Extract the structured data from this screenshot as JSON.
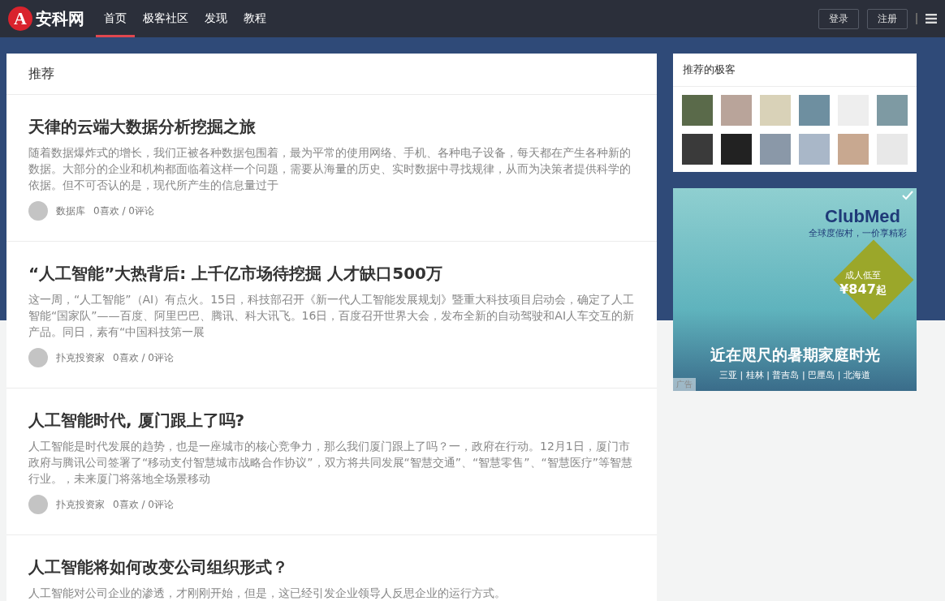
{
  "header": {
    "logo_letter": "A",
    "logo_text": "安科网",
    "nav": [
      {
        "label": "首页",
        "selected": true
      },
      {
        "label": "极客社区",
        "selected": false
      },
      {
        "label": "发现",
        "selected": false
      },
      {
        "label": "教程",
        "selected": false
      }
    ],
    "login": "登录",
    "register": "注册"
  },
  "feed": {
    "title": "推荐",
    "articles": [
      {
        "title": "天律的云端大数据分析挖掘之旅",
        "summary": "随着数据爆炸式的增长，我们正被各种数据包围着，最为平常的使用网络、手机、各种电子设备，每天都在产生各种新的数据。大部分的企业和机构都面临着这样一个问题，需要从海量的历史、实时数据中寻找规律，从而为决策者提供科学的依据。但不可否认的是，现代所产生的信息量过于",
        "author": "数据库",
        "stats": "0喜欢 / 0评论"
      },
      {
        "title": "“人工智能”大热背后: 上千亿市场待挖掘 人才缺口500万",
        "summary": "这一周，“人工智能”（AI）有点火。15日，科技部召开《新一代人工智能发展规划》暨重大科技项目启动会，确定了人工智能“国家队”——百度、阿里巴巴、腾讯、科大讯飞。16日，百度召开世界大会，发布全新的自动驾驶和AI人车交互的新产品。同日，素有“中国科技第一展",
        "author": "扑克投资家",
        "stats": "0喜欢 / 0评论"
      },
      {
        "title": "人工智能时代, 厦门跟上了吗?",
        "summary": "人工智能是时代发展的趋势，也是一座城市的核心竞争力，那么我们厦门跟上了吗？一，政府在行动。12月1日，厦门市政府与腾讯公司签署了“移动支付智慧城市战略合作协议”，双方将共同发展“智慧交通”、“智慧零售”、“智慧医疗”等智慧行业。，未来厦门将落地全场景移动",
        "author": "扑克投资家",
        "stats": "0喜欢 / 0评论"
      },
      {
        "title": "人工智能将如何改变公司组织形式？",
        "summary": "人工智能对公司企业的渗透，才刚刚开始，但是，这已经引发企业领导人反思企业的运行方式。"
      }
    ]
  },
  "sidebar": {
    "geeks_title": "推荐的极客",
    "geeks": [
      {
        "color": "#5a6a4a"
      },
      {
        "color": "#b9a49a"
      },
      {
        "color": "#d9d2b8"
      },
      {
        "color": "#6e8fa0"
      },
      {
        "color": "#eeeeee"
      },
      {
        "color": "#7e9aa3"
      },
      {
        "color": "#3a3a3a"
      },
      {
        "color": "#222222"
      },
      {
        "color": "#8a98a8"
      },
      {
        "color": "#a9b7c8"
      },
      {
        "color": "#c8a890"
      },
      {
        "color": "#e8e8e8"
      }
    ],
    "ad": {
      "brand": "ClubMed",
      "slogan": "全球度假村，一价享精彩",
      "price_label": "成人低至",
      "price": "¥847",
      "price_unit": "起",
      "headline": "近在咫尺的暑期家庭时光",
      "destinations": "三亚 | 桂林 | 普吉岛 | 巴厘岛 | 北海道",
      "tag": "广告"
    }
  }
}
